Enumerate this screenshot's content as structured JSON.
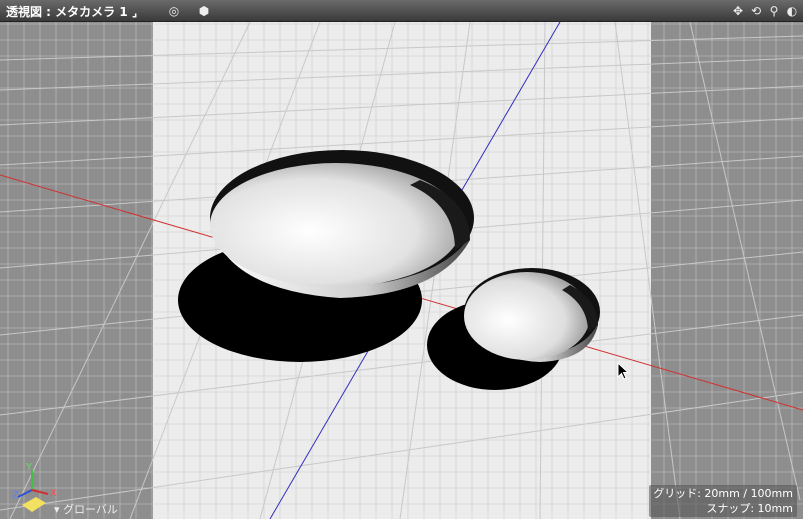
{
  "window": {
    "title": "透視図 : メタカメラ 1 ⌟"
  },
  "toolbar_right_icons": [
    "move-view-icon",
    "rotate-view-icon",
    "zoom-view-icon",
    "display-mode-icon"
  ],
  "toolbar_left_icons": [
    "target-icon",
    "cube-icon"
  ],
  "overlay": {
    "grid_label": "グリッド: 20mm / 100mm",
    "snap_label": "スナップ: 10mm",
    "coordinate_mode": "▾ グローバル"
  },
  "axes": {
    "y": "Y",
    "x": "X",
    "z": "Z"
  },
  "colors": {
    "x_axis": "#d03030",
    "y_axis": "#3030c0",
    "floor": "#e8e8e8",
    "side_panel": "#8e8e8e",
    "shadow": "#000000"
  }
}
